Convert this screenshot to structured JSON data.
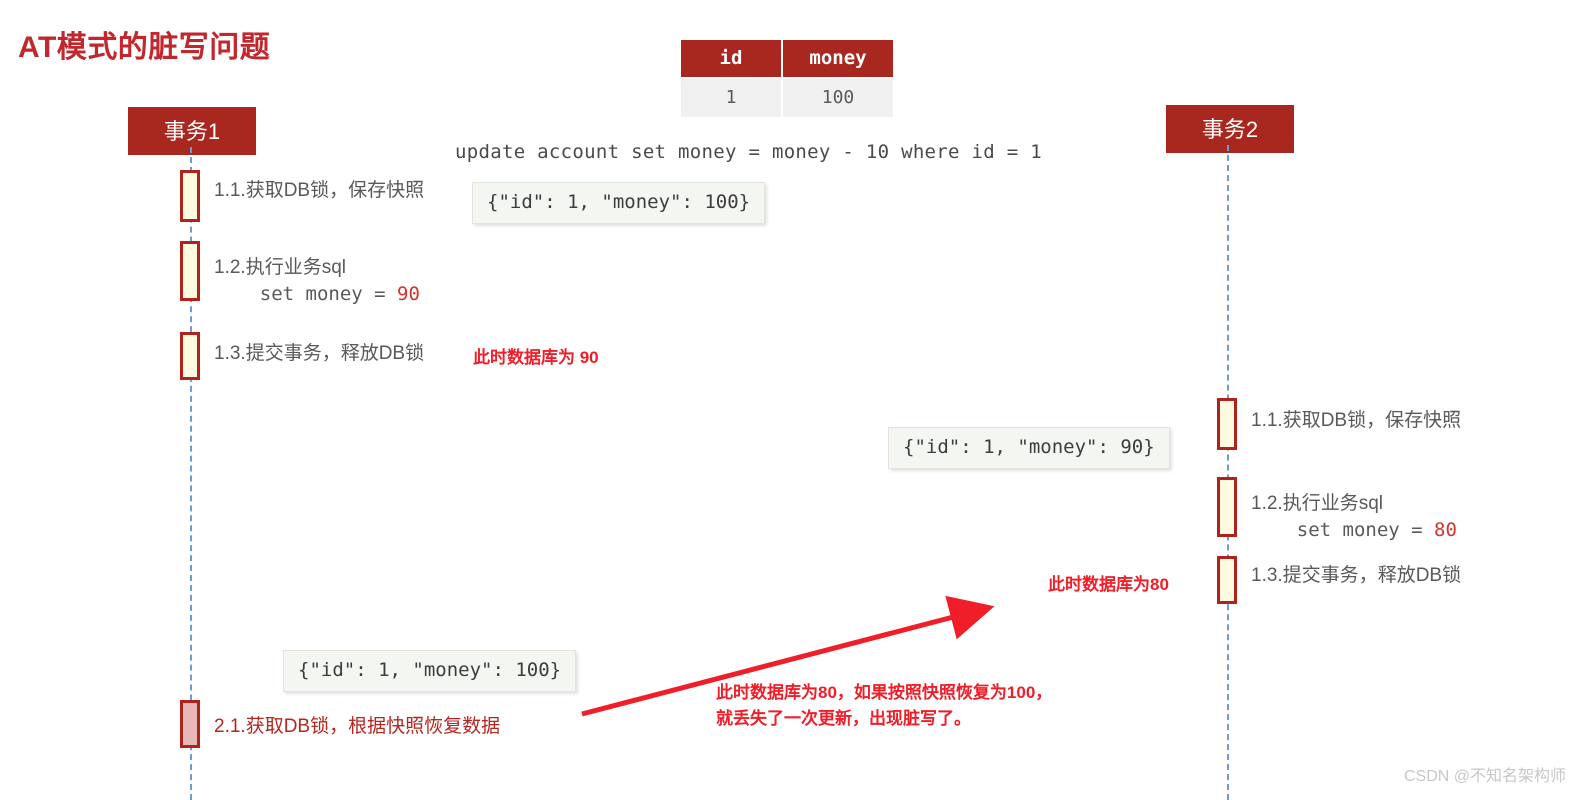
{
  "title": "AT模式的脏写问题",
  "account_table": {
    "headers": [
      "id",
      "money"
    ],
    "rows": [
      [
        "1",
        "100"
      ]
    ]
  },
  "sql": "update account set money = money - 10 where id = 1",
  "actors": {
    "left": "事务1",
    "right": "事务2"
  },
  "left_steps": [
    {
      "label": "1.1.获取DB锁，保存快照"
    },
    {
      "label_line1": "1.2.执行业务sql",
      "label_line2": "    set money = ",
      "value": "90"
    },
    {
      "label": "1.3.提交事务，释放DB锁"
    },
    {
      "label": "2.1.获取DB锁，根据快照恢复数据"
    }
  ],
  "right_steps": [
    {
      "label": "1.1.获取DB锁，保存快照"
    },
    {
      "label_line1": "1.2.执行业务sql",
      "label_line2": "    set money = ",
      "value": "80"
    },
    {
      "label": "1.3.提交事务，释放DB锁"
    }
  ],
  "json_boxes": {
    "snapshot_100_top": "{\"id\": 1, \"money\": 100}",
    "snapshot_90_mid": "{\"id\": 1, \"money\": 90}",
    "snapshot_100_bottom": "{\"id\": 1, \"money\": 100}"
  },
  "annotations": {
    "db_is_90": "此时数据库为 90",
    "db_is_80": "此时数据库为80",
    "dirty_write_line1": "此时数据库为80，如果按照快照恢复为100，",
    "dirty_write_line2": "就丢失了一次更新，出现脏写了。"
  },
  "watermark": "CSDN @不知名架构师",
  "colors": {
    "brand_red": "#A8271F",
    "title_red": "#C1272D",
    "annotation_red": "#F01E28",
    "lifeline_blue": "#6E9BD1",
    "activation_fill": "#FCFBE2",
    "activation_dirty_fill": "#E6B9B7"
  }
}
